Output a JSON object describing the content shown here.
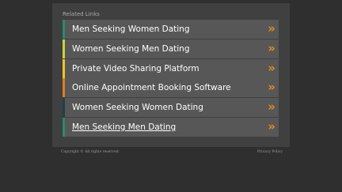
{
  "related_links": {
    "title": "Related Links",
    "items": [
      {
        "label": "Men Seeking Women Dating",
        "stripe_color": "#2a8a6e",
        "arrow": "»"
      },
      {
        "label": "Women Seeking Men Dating",
        "stripe_color": "#c9d33a",
        "arrow": "»"
      },
      {
        "label": "Private Video Sharing Platform",
        "stripe_color": "#f0c71e",
        "arrow": "»"
      },
      {
        "label": "Online Appointment Booking Software",
        "stripe_color": "#e07b1e",
        "arrow": "»"
      },
      {
        "label": "Women Seeking Women Dating",
        "stripe_color": "#1e3e52",
        "arrow": "»"
      },
      {
        "label": "Men Seeking Men Dating",
        "stripe_color": "#2a8a6e",
        "arrow": "»"
      }
    ]
  },
  "footer": {
    "copyright": "Copyright ©   All rights reserved.",
    "privacy": "Privacy Policy"
  }
}
